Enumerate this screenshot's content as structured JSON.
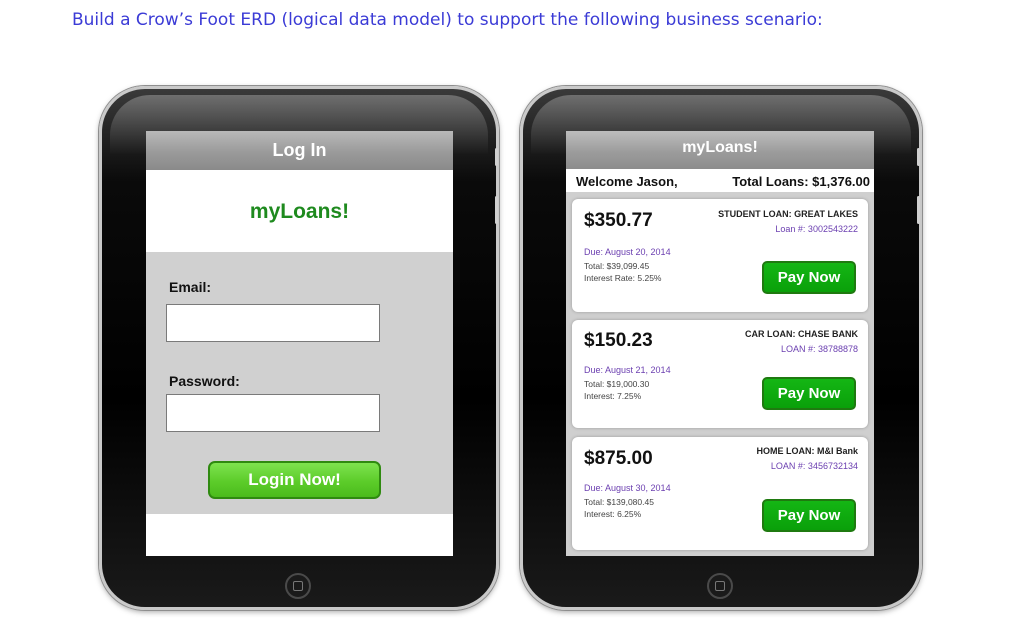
{
  "instruction": "Build a Crow’s Foot ERD (logical data model) to support the following business scenario:",
  "login_screen": {
    "title": "Log In",
    "brand": "myLoans!",
    "email_label": "Email:",
    "email_value": "",
    "password_label": "Password:",
    "password_value": "",
    "login_button": "Login Now!"
  },
  "loans_screen": {
    "title": "myLoans!",
    "welcome": "Welcome Jason,",
    "total_loans": "Total Loans: $1,376.00",
    "loans": [
      {
        "amount": "$350.77",
        "name": "STUDENT LOAN: GREAT LAKES",
        "loan_number": "Loan #: 3002543222",
        "due": "Due: August 20, 2014",
        "total": "Total: $39,099.45",
        "interest": "Interest Rate: 5.25%",
        "pay_button": "Pay Now"
      },
      {
        "amount": "$150.23",
        "name": "CAR LOAN: CHASE BANK",
        "loan_number": "LOAN #: 38788878",
        "due": "Due: August 21, 2014",
        "total": "Total: $19,000.30",
        "interest": "Interest: 7.25%",
        "pay_button": "Pay Now"
      },
      {
        "amount": "$875.00",
        "name": "HOME LOAN: M&I Bank",
        "loan_number": "LOAN #: 3456732134",
        "due": "Due: August 30, 2014",
        "total": "Total: $139,080.45",
        "interest": "Interest: 6.25%",
        "pay_button": "Pay Now"
      }
    ]
  },
  "colors": {
    "instruction_text": "#3b3bd6",
    "brand_green": "#1e8a1e",
    "button_green": "#5ccc2a",
    "pay_green": "#0aa00a",
    "loan_number_purple": "#6b3fb0"
  }
}
